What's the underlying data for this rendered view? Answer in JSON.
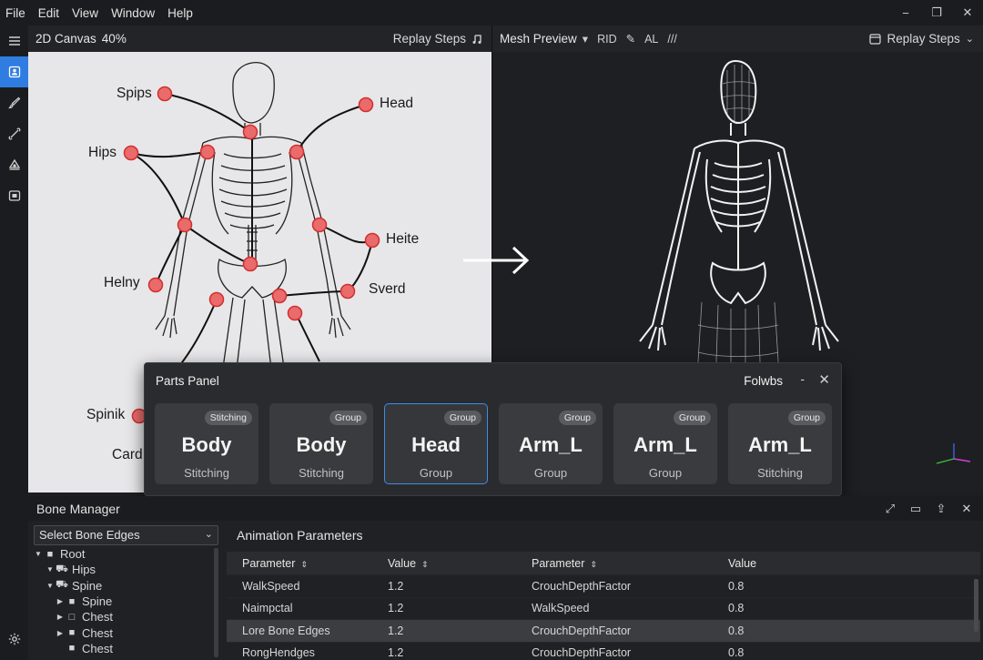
{
  "menu": [
    "File",
    "Edit",
    "View",
    "Window",
    "Help"
  ],
  "window_controls": [
    "−",
    "❐",
    "✕"
  ],
  "canvas2d": {
    "title": "2D Canvas",
    "zoom": "40%",
    "replay_label": "Replay Steps",
    "labels": {
      "spips": "Spips",
      "head": "Head",
      "hips": "Hips",
      "heite": "Heite",
      "helny": "Helny",
      "sverd": "Sverd",
      "spinik": "Spinik",
      "card": "Card"
    }
  },
  "preview": {
    "title": "Mesh Preview",
    "tool_rid": "RID",
    "tool_al": "AL",
    "replay_label": "Replay Steps"
  },
  "parts_panel": {
    "title": "Parts Panel",
    "extra": "Folwbs",
    "minimize": "-",
    "close": "✕",
    "cards": [
      {
        "badge": "Stitching",
        "name": "Body",
        "sub": "Stitching"
      },
      {
        "badge": "Group",
        "name": "Body",
        "sub": "Stitching"
      },
      {
        "badge": "Group",
        "name": "Head",
        "sub": "Group"
      },
      {
        "badge": "Group",
        "name": "Arm_L",
        "sub": "Group"
      },
      {
        "badge": "Group",
        "name": "Arm_L",
        "sub": "Group"
      },
      {
        "badge": "Group",
        "name": "Arm_L",
        "sub": "Stitching"
      }
    ]
  },
  "bone_manager": {
    "title": "Bone Manager",
    "select_value": "Select Bone Edges",
    "tree": [
      {
        "label": "Root",
        "indent": 0
      },
      {
        "label": "Hips",
        "indent": 1
      },
      {
        "label": "Spine",
        "indent": 1
      },
      {
        "label": "Spine",
        "indent": 2
      },
      {
        "label": "Chest",
        "indent": 2
      },
      {
        "label": "Chest",
        "indent": 2
      },
      {
        "label": "Chest",
        "indent": 2
      }
    ]
  },
  "anim_params": {
    "title": "Animation Parameters",
    "headers": [
      "Parameter",
      "Value",
      "Parameter",
      "Value"
    ],
    "rows": [
      [
        "WalkSpeed",
        "1.2",
        "CrouchDepthFactor",
        "0.8"
      ],
      [
        "Naimpctal",
        "1.2",
        "WalkSpeed",
        "0.8"
      ],
      [
        "Lore Bone Edges",
        "1.2",
        "CrouchDepthFactor",
        "0.8"
      ],
      [
        "RongHendges",
        "1.2",
        "CrouchDepthFactor",
        "0.8"
      ]
    ]
  },
  "colors": {
    "accent": "#2f7de1",
    "joint": "#e53935",
    "canvas_bg": "#e7e7e9",
    "preview_bg": "#1e1f22"
  }
}
